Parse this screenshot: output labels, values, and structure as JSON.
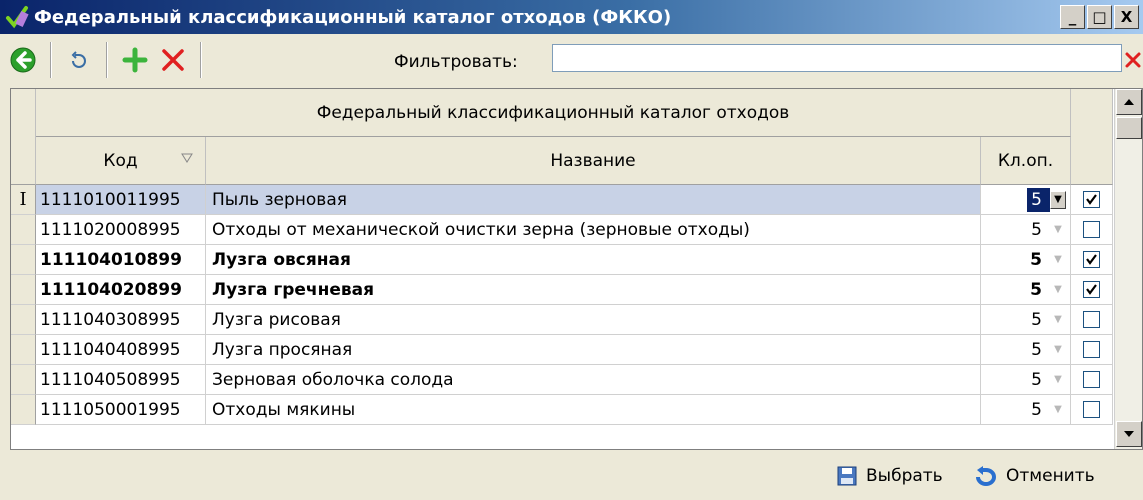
{
  "window": {
    "title": "Федеральный классификационный каталог отходов (ФККО)",
    "minimize": "_",
    "maximize": "□",
    "close": "X"
  },
  "toolbar": {
    "filter_label": "Фильтровать:",
    "filter_value": ""
  },
  "grid": {
    "group_header": "Федеральный классификационный каталог отходов",
    "columns": {
      "code": "Код",
      "name": "Название",
      "class": "Кл.оп."
    },
    "current_row_indicator": "I",
    "rows": [
      {
        "code": "1111010011995",
        "name": "Пыль зерновая",
        "class": "5",
        "checked": true,
        "bold": false,
        "selected": true
      },
      {
        "code": "1111020008995",
        "name": "Отходы от механической очистки зерна (зерновые отходы)",
        "class": "5",
        "checked": false,
        "bold": false,
        "selected": false
      },
      {
        "code": "111104010899",
        "name": "Лузга овсяная",
        "class": "5",
        "checked": true,
        "bold": true,
        "selected": false
      },
      {
        "code": "111104020899",
        "name": "Лузга гречневая",
        "class": "5",
        "checked": true,
        "bold": true,
        "selected": false
      },
      {
        "code": "1111040308995",
        "name": "Лузга рисовая",
        "class": "5",
        "checked": false,
        "bold": false,
        "selected": false
      },
      {
        "code": "1111040408995",
        "name": "Лузга просяная",
        "class": "5",
        "checked": false,
        "bold": false,
        "selected": false
      },
      {
        "code": "1111040508995",
        "name": "Зерновая оболочка солода",
        "class": "5",
        "checked": false,
        "bold": false,
        "selected": false
      },
      {
        "code": "1111050001995",
        "name": "Отходы мякины",
        "class": "5",
        "checked": false,
        "bold": false,
        "selected": false
      }
    ]
  },
  "buttons": {
    "select": "Выбрать",
    "cancel": "Отменить"
  },
  "colors": {
    "accent": "#0a246a",
    "selected_row": "#c8d2e6",
    "add_icon": "#3cb43c",
    "delete_icon": "#e02020"
  }
}
